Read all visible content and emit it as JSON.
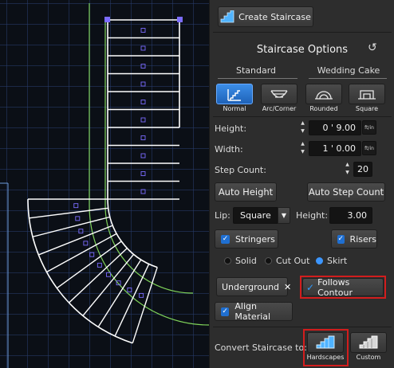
{
  "header": {
    "create_label": "Create Staircase"
  },
  "options": {
    "title": "Staircase Options",
    "group_standard": "Standard",
    "group_wedding": "Wedding Cake",
    "styles": [
      {
        "label": "Normal",
        "icon": "normal-stair-icon",
        "selected": true
      },
      {
        "label": "Arc/Corner",
        "icon": "arc-stair-icon",
        "selected": false
      },
      {
        "label": "Rounded",
        "icon": "rounded-stair-icon",
        "selected": false
      },
      {
        "label": "Square",
        "icon": "square-stair-icon",
        "selected": false
      }
    ],
    "height": {
      "label": "Height:",
      "value": "0 ' 9.00",
      "unit": "ft/in"
    },
    "width": {
      "label": "Width:",
      "value": "1 ' 0.00",
      "unit": "ft/in"
    },
    "step_count": {
      "label": "Step Count:",
      "value": "20"
    },
    "auto_height_label": "Auto Height",
    "auto_step_count_label": "Auto Step Count",
    "lip": {
      "label": "Lip:",
      "value": "Square"
    },
    "lip_height": {
      "label": "Height:",
      "value": "3.00"
    },
    "stringers_label": "Stringers",
    "risers_label": "Risers",
    "skirt_modes": [
      {
        "label": "Solid",
        "selected": false
      },
      {
        "label": "Cut Out",
        "selected": false
      },
      {
        "label": "Skirt",
        "selected": true
      }
    ],
    "underground_label": "Underground",
    "follows_contour_label": "Follows Contour",
    "align_material_label": "Align Material"
  },
  "convert": {
    "label": "Convert Staircase to:",
    "hardscapes_label": "Hardscapes",
    "custom_label": "Custom"
  },
  "colors": {
    "accent": "#1f6fd1",
    "highlight": "#d21d1d",
    "outline": "#7fd35a",
    "handle": "#7b6cff"
  }
}
